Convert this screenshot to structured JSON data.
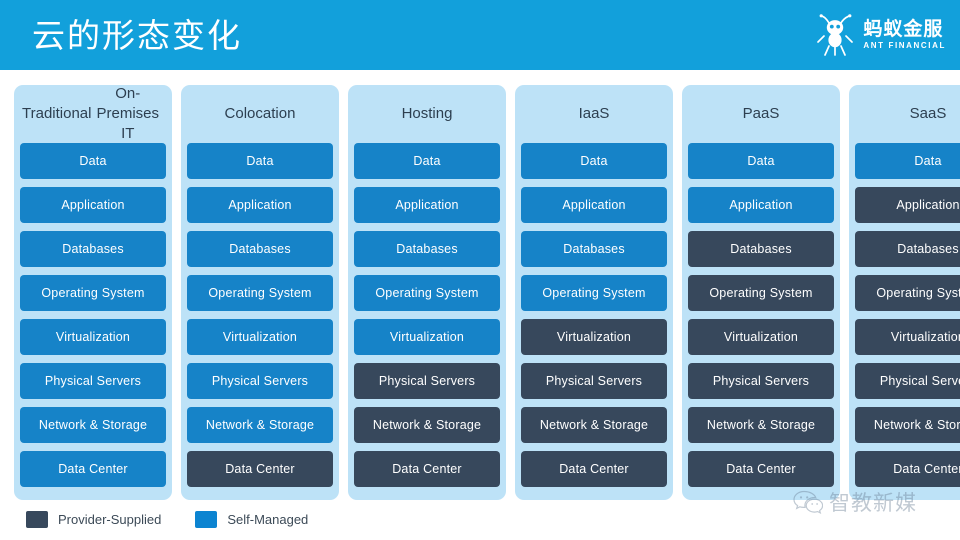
{
  "header": {
    "title": "云的形态变化",
    "brand": {
      "icon": "ant-mascot-icon",
      "name_cn": "蚂蚁金服",
      "name_en": "ANT FINANCIAL"
    },
    "bar_color": "#12a0db"
  },
  "colors": {
    "self_managed": "#1683c8",
    "provider_supplied": "#37485c",
    "column_bg": "#bde2f7",
    "header_text": "#2d3f50"
  },
  "layers": [
    "Data",
    "Application",
    "Databases",
    "Operating System",
    "Virtualization",
    "Physical Servers",
    "Network & Storage",
    "Data Center"
  ],
  "columns": [
    {
      "title": "Traditional\nOn-Premises IT",
      "title_lines": [
        "Traditional",
        "On-Premises IT"
      ],
      "cells": [
        {
          "label": "Data",
          "owner": "self"
        },
        {
          "label": "Application",
          "owner": "self"
        },
        {
          "label": "Databases",
          "owner": "self"
        },
        {
          "label": "Operating System",
          "owner": "self"
        },
        {
          "label": "Virtualization",
          "owner": "self"
        },
        {
          "label": "Physical Servers",
          "owner": "self"
        },
        {
          "label": "Network & Storage",
          "owner": "self"
        },
        {
          "label": "Data Center",
          "owner": "self"
        }
      ]
    },
    {
      "title": "Colocation",
      "title_lines": [
        "Colocation"
      ],
      "cells": [
        {
          "label": "Data",
          "owner": "self"
        },
        {
          "label": "Application",
          "owner": "self"
        },
        {
          "label": "Databases",
          "owner": "self"
        },
        {
          "label": "Operating System",
          "owner": "self"
        },
        {
          "label": "Virtualization",
          "owner": "self"
        },
        {
          "label": "Physical Servers",
          "owner": "self"
        },
        {
          "label": "Network & Storage",
          "owner": "self"
        },
        {
          "label": "Data Center",
          "owner": "provider"
        }
      ]
    },
    {
      "title": "Hosting",
      "title_lines": [
        "Hosting"
      ],
      "cells": [
        {
          "label": "Data",
          "owner": "self"
        },
        {
          "label": "Application",
          "owner": "self"
        },
        {
          "label": "Databases",
          "owner": "self"
        },
        {
          "label": "Operating System",
          "owner": "self"
        },
        {
          "label": "Virtualization",
          "owner": "self"
        },
        {
          "label": "Physical Servers",
          "owner": "provider"
        },
        {
          "label": "Network & Storage",
          "owner": "provider"
        },
        {
          "label": "Data Center",
          "owner": "provider"
        }
      ]
    },
    {
      "title": "IaaS",
      "title_lines": [
        "IaaS"
      ],
      "cells": [
        {
          "label": "Data",
          "owner": "self"
        },
        {
          "label": "Application",
          "owner": "self"
        },
        {
          "label": "Databases",
          "owner": "self"
        },
        {
          "label": "Operating System",
          "owner": "self"
        },
        {
          "label": "Virtualization",
          "owner": "provider"
        },
        {
          "label": "Physical Servers",
          "owner": "provider"
        },
        {
          "label": "Network & Storage",
          "owner": "provider"
        },
        {
          "label": "Data Center",
          "owner": "provider"
        }
      ]
    },
    {
      "title": "PaaS",
      "title_lines": [
        "PaaS"
      ],
      "cells": [
        {
          "label": "Data",
          "owner": "self"
        },
        {
          "label": "Application",
          "owner": "self"
        },
        {
          "label": "Databases",
          "owner": "provider"
        },
        {
          "label": "Operating System",
          "owner": "provider"
        },
        {
          "label": "Virtualization",
          "owner": "provider"
        },
        {
          "label": "Physical Servers",
          "owner": "provider"
        },
        {
          "label": "Network & Storage",
          "owner": "provider"
        },
        {
          "label": "Data Center",
          "owner": "provider"
        }
      ]
    },
    {
      "title": "SaaS",
      "title_lines": [
        "SaaS"
      ],
      "cells": [
        {
          "label": "Data",
          "owner": "self"
        },
        {
          "label": "Application",
          "owner": "provider"
        },
        {
          "label": "Databases",
          "owner": "provider"
        },
        {
          "label": "Operating System",
          "owner": "provider"
        },
        {
          "label": "Virtualization",
          "owner": "provider"
        },
        {
          "label": "Physical Servers",
          "owner": "provider"
        },
        {
          "label": "Network & Storage",
          "owner": "provider"
        },
        {
          "label": "Data Center",
          "owner": "provider"
        }
      ]
    }
  ],
  "legend": [
    {
      "key": "provider",
      "label": "Provider-Supplied",
      "color": "#37485c"
    },
    {
      "key": "self",
      "label": "Self-Managed",
      "color": "#0c84d1"
    }
  ],
  "watermark": {
    "icon": "wechat-icon",
    "text": "智教新媒"
  }
}
